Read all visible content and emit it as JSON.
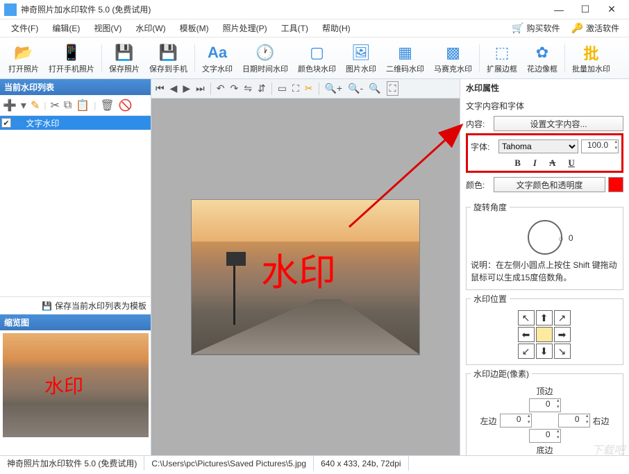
{
  "title": "神奇照片加水印软件 5.0 (免费试用)",
  "menus": [
    "文件(F)",
    "编辑(E)",
    "视图(V)",
    "水印(W)",
    "模板(M)",
    "照片处理(P)",
    "工具(T)",
    "帮助(H)"
  ],
  "rightlinks": {
    "buy": "购买软件",
    "activate": "激活软件"
  },
  "toolbar": [
    {
      "label": "打开照片",
      "color": "#f5b800"
    },
    {
      "label": "打开手机照片",
      "color": "#3b8ee0"
    },
    {
      "label": "保存照片",
      "color": "#8e5bd6"
    },
    {
      "label": "保存到手机",
      "color": "#b05bd6"
    },
    {
      "label": "文字水印",
      "color": "#3b8ee0",
      "text": "Aa"
    },
    {
      "label": "日期时间水印",
      "color": "#3b8ee0"
    },
    {
      "label": "颜色块水印",
      "color": "#3b8ee0"
    },
    {
      "label": "图片水印",
      "color": "#3b8ee0"
    },
    {
      "label": "二维码水印",
      "color": "#3b8ee0"
    },
    {
      "label": "马赛克水印",
      "color": "#3b8ee0"
    },
    {
      "label": "扩展边框",
      "color": "#3b8ee0"
    },
    {
      "label": "花边像框",
      "color": "#3b8ee0"
    },
    {
      "label": "批量加水印",
      "color": "#f5b800",
      "text": "批"
    }
  ],
  "left": {
    "header": "当前水印列表",
    "item": "文字水印",
    "savetpl": "保存当前水印列表为模板",
    "thumbhdr": "缩览图"
  },
  "watermark_text": "水印",
  "right": {
    "header": "水印属性",
    "sec1": "文字内容和字体",
    "content_lbl": "内容:",
    "content_btn": "设置文字内容...",
    "font_lbl": "字体:",
    "font_name": "Tahoma",
    "font_size": "100.0",
    "color_lbl": "颜色:",
    "color_btn": "文字颜色和透明度",
    "rotate_hdr": "旋转角度",
    "rotate_val": "0",
    "rotate_help": "说明：在左侧小圆点上按住 Shift 键拖动鼠标可以生成15度倍数角。",
    "pos_hdr": "水印位置",
    "margin_hdr": "水印边距(像素)",
    "margin_top": "顶边",
    "margin_left": "左边",
    "margin_right": "右边",
    "margin_bottom": "底边",
    "margin_val": "0"
  },
  "status": {
    "app": "神奇照片加水印软件 5.0 (免费试用)",
    "path": "C:\\Users\\pc\\Pictures\\Saved Pictures\\5.jpg",
    "info": "640 x 433, 24b, 72dpi"
  },
  "site": "下载吧"
}
